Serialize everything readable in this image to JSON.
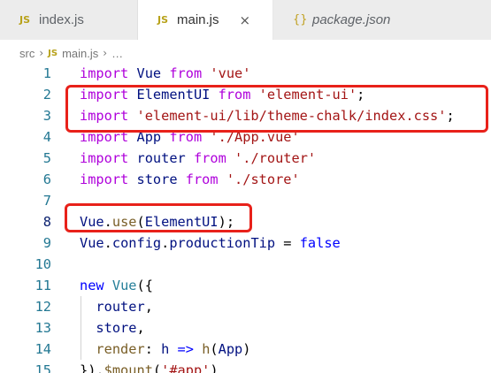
{
  "tabs": [
    {
      "icon": "JS",
      "label": "index.js",
      "active": false,
      "italic": false
    },
    {
      "icon": "JS",
      "label": "main.js",
      "active": true,
      "italic": false,
      "close": "×"
    },
    {
      "icon": "{}",
      "label": "package.json",
      "active": false,
      "italic": true
    }
  ],
  "breadcrumb": {
    "folder": "src",
    "separator": "›",
    "file_icon": "JS",
    "file": "main.js",
    "more": "…"
  },
  "lines": [
    {
      "n": "1",
      "tokens": [
        [
          "kw2",
          "import"
        ],
        [
          "pl",
          " "
        ],
        [
          "id",
          "Vue"
        ],
        [
          "pl",
          " "
        ],
        [
          "kw2",
          "from"
        ],
        [
          "pl",
          " "
        ],
        [
          "str",
          "'vue'"
        ]
      ]
    },
    {
      "n": "2",
      "tokens": [
        [
          "kw2",
          "import"
        ],
        [
          "pl",
          " "
        ],
        [
          "id",
          "ElementUI"
        ],
        [
          "pl",
          " "
        ],
        [
          "kw2",
          "from"
        ],
        [
          "pl",
          " "
        ],
        [
          "str",
          "'element-ui'"
        ],
        [
          "pl",
          ";"
        ]
      ]
    },
    {
      "n": "3",
      "tokens": [
        [
          "kw2",
          "import"
        ],
        [
          "pl",
          " "
        ],
        [
          "str",
          "'element-ui/lib/theme-chalk/index.css'"
        ],
        [
          "pl",
          ";"
        ]
      ]
    },
    {
      "n": "4",
      "tokens": [
        [
          "kw2",
          "import"
        ],
        [
          "pl",
          " "
        ],
        [
          "id",
          "App"
        ],
        [
          "pl",
          " "
        ],
        [
          "kw2",
          "from"
        ],
        [
          "pl",
          " "
        ],
        [
          "str",
          "'./App.vue'"
        ]
      ]
    },
    {
      "n": "5",
      "tokens": [
        [
          "kw2",
          "import"
        ],
        [
          "pl",
          " "
        ],
        [
          "id",
          "router"
        ],
        [
          "pl",
          " "
        ],
        [
          "kw2",
          "from"
        ],
        [
          "pl",
          " "
        ],
        [
          "str",
          "'./router'"
        ]
      ]
    },
    {
      "n": "6",
      "tokens": [
        [
          "kw2",
          "import"
        ],
        [
          "pl",
          " "
        ],
        [
          "id",
          "store"
        ],
        [
          "pl",
          " "
        ],
        [
          "kw2",
          "from"
        ],
        [
          "pl",
          " "
        ],
        [
          "str",
          "'./store'"
        ]
      ]
    },
    {
      "n": "7",
      "tokens": []
    },
    {
      "n": "8",
      "tokens": [
        [
          "id",
          "Vue"
        ],
        [
          "pl",
          "."
        ],
        [
          "fn",
          "use"
        ],
        [
          "pl",
          "("
        ],
        [
          "id",
          "ElementUI"
        ],
        [
          "pl",
          ");"
        ]
      ]
    },
    {
      "n": "9",
      "tokens": [
        [
          "id",
          "Vue"
        ],
        [
          "pl",
          "."
        ],
        [
          "id",
          "config"
        ],
        [
          "pl",
          "."
        ],
        [
          "id",
          "productionTip"
        ],
        [
          "pl",
          " = "
        ],
        [
          "kw",
          "false"
        ]
      ]
    },
    {
      "n": "10",
      "tokens": []
    },
    {
      "n": "11",
      "tokens": [
        [
          "kw",
          "new"
        ],
        [
          "pl",
          " "
        ],
        [
          "cls",
          "Vue"
        ],
        [
          "pl",
          "({"
        ]
      ]
    },
    {
      "n": "12",
      "tokens": [
        [
          "pl",
          "  "
        ],
        [
          "id",
          "router"
        ],
        [
          "pl",
          ","
        ]
      ],
      "guide": true
    },
    {
      "n": "13",
      "tokens": [
        [
          "pl",
          "  "
        ],
        [
          "id",
          "store"
        ],
        [
          "pl",
          ","
        ]
      ],
      "guide": true
    },
    {
      "n": "14",
      "tokens": [
        [
          "pl",
          "  "
        ],
        [
          "fn",
          "render"
        ],
        [
          "pl",
          ": "
        ],
        [
          "id",
          "h"
        ],
        [
          "pl",
          " "
        ],
        [
          "kw",
          "=>"
        ],
        [
          "pl",
          " "
        ],
        [
          "fn",
          "h"
        ],
        [
          "pl",
          "("
        ],
        [
          "id",
          "App"
        ],
        [
          "pl",
          ")"
        ]
      ],
      "guide": true
    },
    {
      "n": "15",
      "tokens": [
        [
          "pl",
          "})."
        ],
        [
          "fn",
          "$mount"
        ],
        [
          "pl",
          "("
        ],
        [
          "str",
          "'#app'"
        ],
        [
          "pl",
          ")"
        ]
      ]
    }
  ],
  "current_line": "8",
  "colors": {
    "annotation": "#e8211a",
    "keyword_control": "#af00db",
    "keyword": "#0000ff",
    "string": "#a31515",
    "identifier": "#001080",
    "function": "#795e26",
    "class": "#267f99",
    "line_number": "#237893"
  }
}
